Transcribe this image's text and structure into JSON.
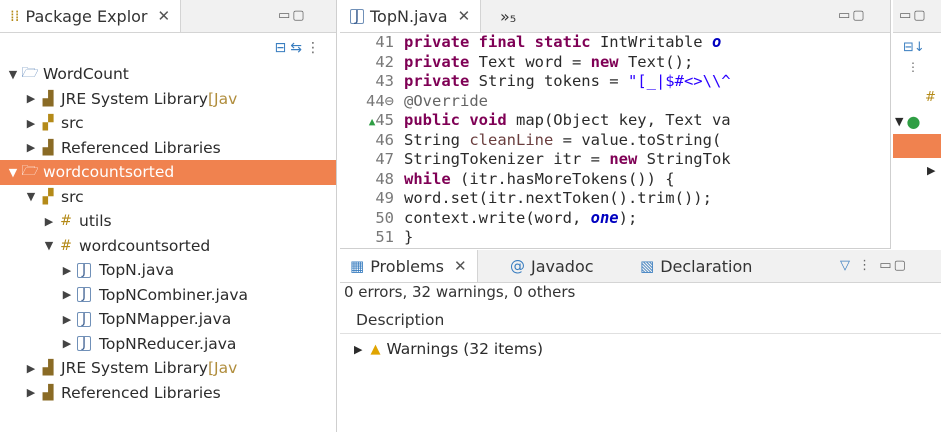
{
  "explorer": {
    "tab_label": "Package Explor",
    "tree": [
      {
        "label": "WordCount",
        "indent": 0,
        "twisty": "▼",
        "icon": "project-icon",
        "glyph": "🗁"
      },
      {
        "label": "JRE System Library",
        "suffix": " [Jav",
        "indent": 1,
        "twisty": "▶",
        "icon": "library-icon",
        "glyph": "▟"
      },
      {
        "label": "src",
        "indent": 1,
        "twisty": "▶",
        "icon": "source-folder-icon",
        "glyph": "▞"
      },
      {
        "label": "Referenced Libraries",
        "indent": 1,
        "twisty": "▶",
        "icon": "library-icon",
        "glyph": "▟"
      },
      {
        "label": "wordcountsorted",
        "indent": 0,
        "twisty": "▼",
        "icon": "project-icon",
        "glyph": "🗁",
        "selected": true
      },
      {
        "label": "src",
        "indent": 1,
        "twisty": "▼",
        "icon": "source-folder-icon",
        "glyph": "▞"
      },
      {
        "label": "utils",
        "indent": 2,
        "twisty": "▶",
        "icon": "package-icon",
        "glyph": "#"
      },
      {
        "label": "wordcountsorted",
        "indent": 2,
        "twisty": "▼",
        "icon": "package-icon",
        "glyph": "#"
      },
      {
        "label": "TopN.java",
        "indent": 3,
        "twisty": "▶",
        "icon": "java-file-icon",
        "glyph": "J"
      },
      {
        "label": "TopNCombiner.java",
        "indent": 3,
        "twisty": "▶",
        "icon": "java-file-icon",
        "glyph": "J"
      },
      {
        "label": "TopNMapper.java",
        "indent": 3,
        "twisty": "▶",
        "icon": "java-file-icon",
        "glyph": "J"
      },
      {
        "label": "TopNReducer.java",
        "indent": 3,
        "twisty": "▶",
        "icon": "java-file-icon",
        "glyph": "J"
      },
      {
        "label": "JRE System Library",
        "suffix": " [Jav",
        "indent": 1,
        "twisty": "▶",
        "icon": "library-icon",
        "glyph": "▟"
      },
      {
        "label": "Referenced Libraries",
        "indent": 1,
        "twisty": "▶",
        "icon": "library-icon",
        "glyph": "▟"
      }
    ]
  },
  "editor": {
    "tab_label": "TopN.java",
    "overflow_label": "»₅",
    "lines": [
      {
        "n": "41",
        "parts": [
          [
            "kw",
            "private final static "
          ],
          [
            "",
            "IntWritable "
          ],
          [
            "fld",
            "o"
          ]
        ]
      },
      {
        "n": "42",
        "parts": [
          [
            "kw",
            "private "
          ],
          [
            "",
            "Text word = "
          ],
          [
            "kw",
            "new "
          ],
          [
            "",
            "Text();"
          ]
        ]
      },
      {
        "n": "43",
        "parts": [
          [
            "kw",
            "private "
          ],
          [
            "",
            "String tokens = "
          ],
          [
            "str",
            "\"[_|$#<>\\\\^"
          ]
        ]
      },
      {
        "n": "44⊖",
        "parts": [
          [
            "ann",
            "@Override"
          ]
        ]
      },
      {
        "n": "45",
        "marker": "▲",
        "parts": [
          [
            "kw",
            "public void "
          ],
          [
            "",
            "map(Object key, Text va"
          ]
        ]
      },
      {
        "n": "46",
        "parts": [
          [
            "",
            "String "
          ],
          [
            "var",
            "cleanLine"
          ],
          [
            "",
            " = value.toString("
          ]
        ]
      },
      {
        "n": "47",
        "parts": [
          [
            "",
            "StringTokenizer itr = "
          ],
          [
            "kw",
            "new "
          ],
          [
            "",
            "StringTok"
          ]
        ]
      },
      {
        "n": "48",
        "parts": [
          [
            "kw",
            "while "
          ],
          [
            "",
            "(itr.hasMoreTokens()) {"
          ]
        ]
      },
      {
        "n": "49",
        "parts": [
          [
            "",
            "word.set(itr.nextToken().trim());"
          ]
        ]
      },
      {
        "n": "50",
        "parts": [
          [
            "",
            "context.write(word, "
          ],
          [
            "fld",
            "one"
          ],
          [
            "",
            ");"
          ]
        ]
      },
      {
        "n": "51",
        "parts": [
          [
            "",
            "}"
          ]
        ]
      }
    ]
  },
  "problems": {
    "tabs": [
      "Problems",
      "Javadoc",
      "Declaration"
    ],
    "status": "0 errors, 32 warnings, 0 others",
    "column_header": "Description",
    "warnings_label": "Warnings (32 items)"
  }
}
